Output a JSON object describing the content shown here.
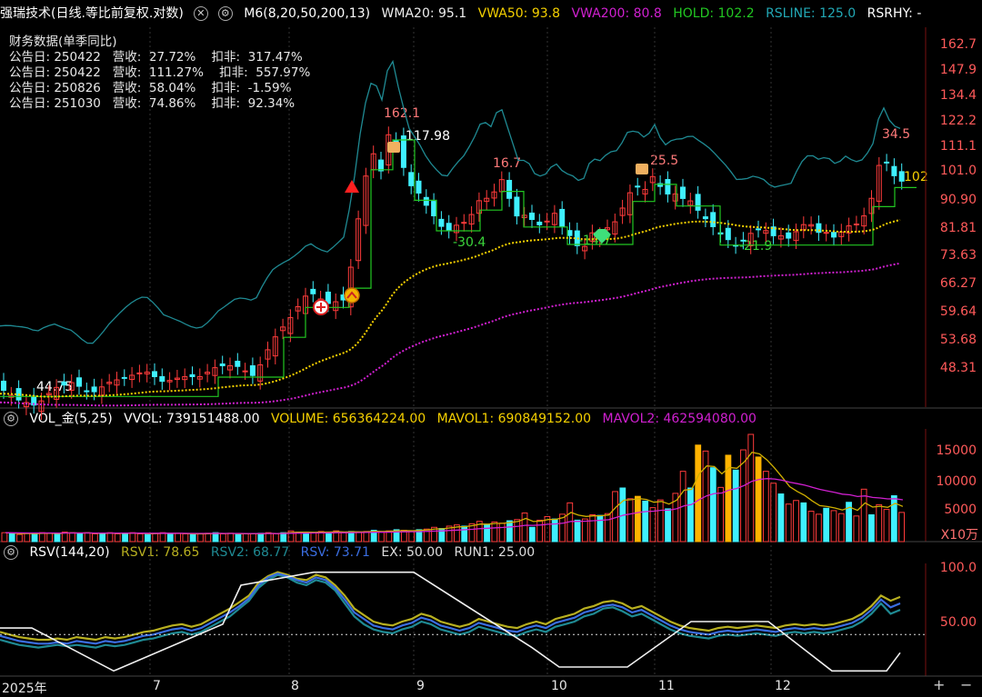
{
  "header": {
    "title": "强瑞技术(日线.等比前复权.对数)",
    "m6": "M6(8,20,50,200,13)",
    "wma20": "WMA20: 95.1",
    "vwa50": "VWA50: 93.8",
    "vwa200": "VWA200: 80.8",
    "hold": "HOLD: 102.2",
    "rsline": "RSLINE: 125.0",
    "rsrhy": "RSRHY: -"
  },
  "financial": {
    "title": "财务数据(单季同比)",
    "rows": [
      "公告日: 250422   营收:  27.72%    扣非:  317.47%",
      "公告日: 250422   营收:  111.27%    扣非:  557.97%",
      "公告日: 250826   营收:  58.04%    扣非:  -1.59%",
      "公告日: 251030   营收:  74.86%    扣非:  92.34%"
    ]
  },
  "vol_header": {
    "title": "VOL_金(5,25)",
    "vvol": "VVOL: 739151488.00",
    "volume": "VOLUME: 656364224.00",
    "mavol1": "MAVOL1: 690849152.00",
    "mavol2": "MAVOL2: 462594080.00",
    "unit": "X10万"
  },
  "rsv_header": {
    "title": "RSV(144,20)",
    "rsv1": "RSV1: 78.65",
    "rsv2": "RSV2: 68.77",
    "rsv": "RSV: 73.71",
    "ex": "EX: 50.00",
    "run1": "RUN1: 25.00"
  },
  "colors": {
    "up": "#ff3b3b",
    "down": "#3ff0ff",
    "wma": "#dddddd",
    "vwa50": "#f5d000",
    "vwa200": "#d020d0",
    "hold": "#22c722",
    "rsline": "#1f8a93"
  },
  "chart_data": [
    {
      "type": "candlestick",
      "ylim": [
        46,
        170
      ],
      "scale": "log",
      "y_ticks": [
        "162.7",
        "147.9",
        "134.4",
        "122.2",
        "111.1",
        "101.0",
        "90.90",
        "81.81",
        "73.63",
        "66.27",
        "59.64",
        "53.68",
        "48.31"
      ],
      "x_ticks": [
        "2025年",
        "7",
        "8",
        "9",
        "10",
        "11",
        "12"
      ],
      "annotations": [
        "162.1",
        "117.98",
        "16.7",
        "-30.4",
        "-14.7",
        "25.5",
        "-21.9",
        "34.5",
        "102",
        "44.75"
      ],
      "close_points": [
        [
          0,
          48
        ],
        [
          20,
          46
        ],
        [
          40,
          45
        ],
        [
          60,
          48
        ],
        [
          80,
          49
        ],
        [
          100,
          47
        ],
        [
          120,
          49
        ],
        [
          140,
          50
        ],
        [
          160,
          51
        ],
        [
          180,
          49
        ],
        [
          200,
          50
        ],
        [
          220,
          50
        ],
        [
          240,
          52
        ],
        [
          260,
          52
        ],
        [
          280,
          50
        ],
        [
          300,
          57
        ],
        [
          320,
          62
        ],
        [
          340,
          68
        ],
        [
          360,
          65
        ],
        [
          380,
          66
        ],
        [
          390,
          80
        ],
        [
          400,
          100
        ],
        [
          410,
          112
        ],
        [
          420,
          104
        ],
        [
          430,
          125
        ],
        [
          440,
          110
        ],
        [
          450,
          100
        ],
        [
          460,
          97
        ],
        [
          470,
          92
        ],
        [
          480,
          88
        ],
        [
          490,
          84
        ],
        [
          500,
          86
        ],
        [
          510,
          87
        ],
        [
          520,
          90
        ],
        [
          530,
          96
        ],
        [
          540,
          94
        ],
        [
          550,
          103
        ],
        [
          560,
          95
        ],
        [
          570,
          88
        ],
        [
          580,
          90
        ],
        [
          590,
          86
        ],
        [
          600,
          87
        ],
        [
          610,
          90
        ],
        [
          620,
          85
        ],
        [
          630,
          82
        ],
        [
          640,
          78
        ],
        [
          650,
          84
        ],
        [
          660,
          83
        ],
        [
          670,
          86
        ],
        [
          680,
          88
        ],
        [
          690,
          96
        ],
        [
          700,
          99
        ],
        [
          710,
          98
        ],
        [
          720,
          104
        ],
        [
          730,
          96
        ],
        [
          740,
          97
        ],
        [
          750,
          95
        ],
        [
          760,
          94
        ],
        [
          770,
          90
        ],
        [
          780,
          87
        ],
        [
          790,
          84
        ],
        [
          800,
          82
        ],
        [
          810,
          80
        ],
        [
          820,
          82
        ],
        [
          830,
          85
        ],
        [
          840,
          85
        ],
        [
          850,
          83
        ],
        [
          860,
          83
        ],
        [
          870,
          82
        ],
        [
          880,
          86
        ],
        [
          890,
          87
        ],
        [
          900,
          84
        ],
        [
          910,
          84
        ],
        [
          920,
          82
        ],
        [
          930,
          86
        ],
        [
          940,
          86
        ],
        [
          950,
          89
        ],
        [
          960,
          96
        ],
        [
          970,
          112
        ],
        [
          980,
          104
        ],
        [
          990,
          101
        ]
      ]
    },
    {
      "type": "bar",
      "title": "VOL_金(5,25)",
      "ylim": [
        0,
        18000
      ],
      "y_ticks": [
        "15000",
        "10000",
        "5000"
      ],
      "values": [
        1500,
        1300,
        1200,
        1400,
        1300,
        1500,
        1400,
        1300,
        1600,
        1500,
        1400,
        1500,
        1300,
        1400,
        1500,
        1300,
        1400,
        1500,
        1300,
        1200,
        1400,
        1500,
        1300,
        1400,
        1300,
        1200,
        1300,
        1400,
        1500,
        1300,
        1400,
        1200,
        1300,
        1300,
        1400,
        1500,
        1300,
        1500,
        1800,
        1600,
        1600,
        1500,
        1700,
        1600,
        1800,
        1500,
        1700,
        1600,
        1700,
        1900,
        1600,
        1800,
        2000,
        1900,
        1800,
        2000,
        2100,
        2400,
        2200,
        2600,
        2800,
        2600,
        3000,
        3400,
        2900,
        3300,
        3100,
        3500,
        3700,
        4800,
        2400,
        3600,
        4200,
        3800,
        4600,
        6500,
        3600,
        3800,
        4500,
        4400,
        4700,
        8400,
        9000,
        7200,
        7600,
        6800,
        5700,
        7000,
        5500,
        8100,
        11800,
        9000,
        16200,
        15200,
        12400,
        9100,
        14500,
        12000,
        15400,
        18000,
        14200,
        11800,
        9800,
        8000,
        6300,
        6900,
        6500,
        5100,
        4600,
        5600,
        5200,
        4700,
        6600,
        4300,
        8800,
        4500,
        6200,
        5400,
        7700,
        4900
      ]
    },
    {
      "type": "line",
      "title": "RSV(144,20)",
      "ylim": [
        18,
        102
      ],
      "y_ticks": [
        "100.0",
        "50.00"
      ],
      "series": [
        {
          "name": "RSV1",
          "values": [
            52,
            50,
            48,
            47,
            46,
            46,
            47,
            46,
            48,
            47,
            46,
            48,
            47,
            48,
            50,
            52,
            53,
            55,
            57,
            58,
            56,
            58,
            62,
            66,
            70,
            75,
            80,
            90,
            95,
            98,
            96,
            93,
            92,
            96,
            94,
            88,
            80,
            70,
            65,
            60,
            58,
            57,
            60,
            62,
            66,
            64,
            60,
            58,
            56,
            58,
            62,
            60,
            58,
            56,
            55,
            58,
            60,
            58,
            62,
            64,
            66,
            70,
            72,
            75,
            76,
            74,
            70,
            72,
            68,
            64,
            60,
            57,
            55,
            54,
            53,
            55,
            56,
            55,
            56,
            57,
            56,
            55,
            57,
            58,
            57,
            58,
            57,
            58,
            60,
            62,
            66,
            72,
            80,
            76,
            79
          ]
        },
        {
          "name": "RSV2",
          "values": [
            46,
            44,
            42,
            41,
            40,
            41,
            42,
            41,
            42,
            41,
            40,
            42,
            41,
            42,
            44,
            46,
            47,
            49,
            51,
            52,
            50,
            52,
            56,
            60,
            64,
            70,
            76,
            86,
            92,
            96,
            94,
            90,
            88,
            92,
            90,
            84,
            74,
            64,
            58,
            54,
            52,
            51,
            54,
            56,
            60,
            58,
            54,
            52,
            50,
            52,
            56,
            54,
            52,
            50,
            49,
            52,
            54,
            52,
            56,
            58,
            60,
            64,
            66,
            70,
            71,
            68,
            64,
            66,
            62,
            58,
            54,
            51,
            49,
            48,
            47,
            49,
            50,
            49,
            50,
            51,
            50,
            49,
            51,
            52,
            51,
            52,
            51,
            52,
            54,
            56,
            60,
            66,
            74,
            66,
            69
          ]
        },
        {
          "name": "RSV",
          "values": [
            49,
            47,
            45,
            44,
            43,
            43,
            44,
            43,
            45,
            44,
            43,
            45,
            44,
            45,
            47,
            49,
            50,
            52,
            54,
            55,
            53,
            55,
            59,
            63,
            67,
            72,
            78,
            88,
            94,
            97,
            95,
            92,
            90,
            94,
            92,
            86,
            77,
            67,
            62,
            57,
            55,
            54,
            57,
            59,
            63,
            61,
            57,
            55,
            53,
            55,
            59,
            57,
            55,
            53,
            52,
            55,
            57,
            55,
            59,
            61,
            63,
            67,
            69,
            72,
            73,
            71,
            67,
            69,
            65,
            61,
            57,
            54,
            52,
            51,
            50,
            52,
            53,
            52,
            53,
            54,
            53,
            52,
            54,
            55,
            54,
            55,
            54,
            55,
            57,
            59,
            63,
            69,
            77,
            71,
            74
          ]
        },
        {
          "name": "EX",
          "values": [
            50,
            50
          ]
        },
        {
          "name": "RUN1",
          "values": [
            [
              0,
              55
            ],
            [
              35,
              55
            ],
            [
              125,
              22
            ],
            [
              245,
              58
            ],
            [
              265,
              88
            ],
            [
              345,
              98
            ],
            [
              455,
              98
            ],
            [
              585,
              40
            ],
            [
              615,
              25
            ],
            [
              690,
              25
            ],
            [
              760,
              60
            ],
            [
              845,
              60
            ],
            [
              915,
              22
            ],
            [
              975,
              22
            ],
            [
              990,
              36
            ]
          ]
        }
      ]
    }
  ]
}
